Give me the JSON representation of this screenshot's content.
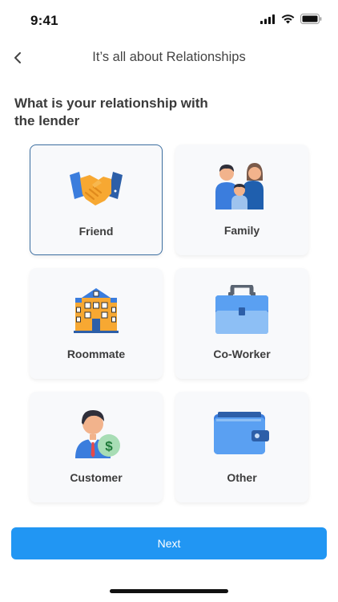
{
  "status_bar": {
    "time": "9:41",
    "icons": [
      "cellular-signal-icon",
      "wifi-icon",
      "battery-icon"
    ]
  },
  "nav": {
    "back_icon": "chevron-left-icon",
    "title": "It’s all about Relationships"
  },
  "question": "What is your relationship with the lender",
  "options": [
    {
      "label": "Friend",
      "icon": "handshake-icon",
      "selected": true
    },
    {
      "label": "Family",
      "icon": "family-icon",
      "selected": false
    },
    {
      "label": "Roommate",
      "icon": "house-icon",
      "selected": false
    },
    {
      "label": "Co-Worker",
      "icon": "briefcase-icon",
      "selected": false
    },
    {
      "label": "Customer",
      "icon": "customer-dollar-icon",
      "selected": false
    },
    {
      "label": "Other",
      "icon": "wallet-icon",
      "selected": false
    }
  ],
  "next_button": {
    "label": "Next"
  },
  "colors": {
    "accent": "#2196f3",
    "selected_border": "#3d6fa1",
    "card_background": "#f8f9fb"
  }
}
